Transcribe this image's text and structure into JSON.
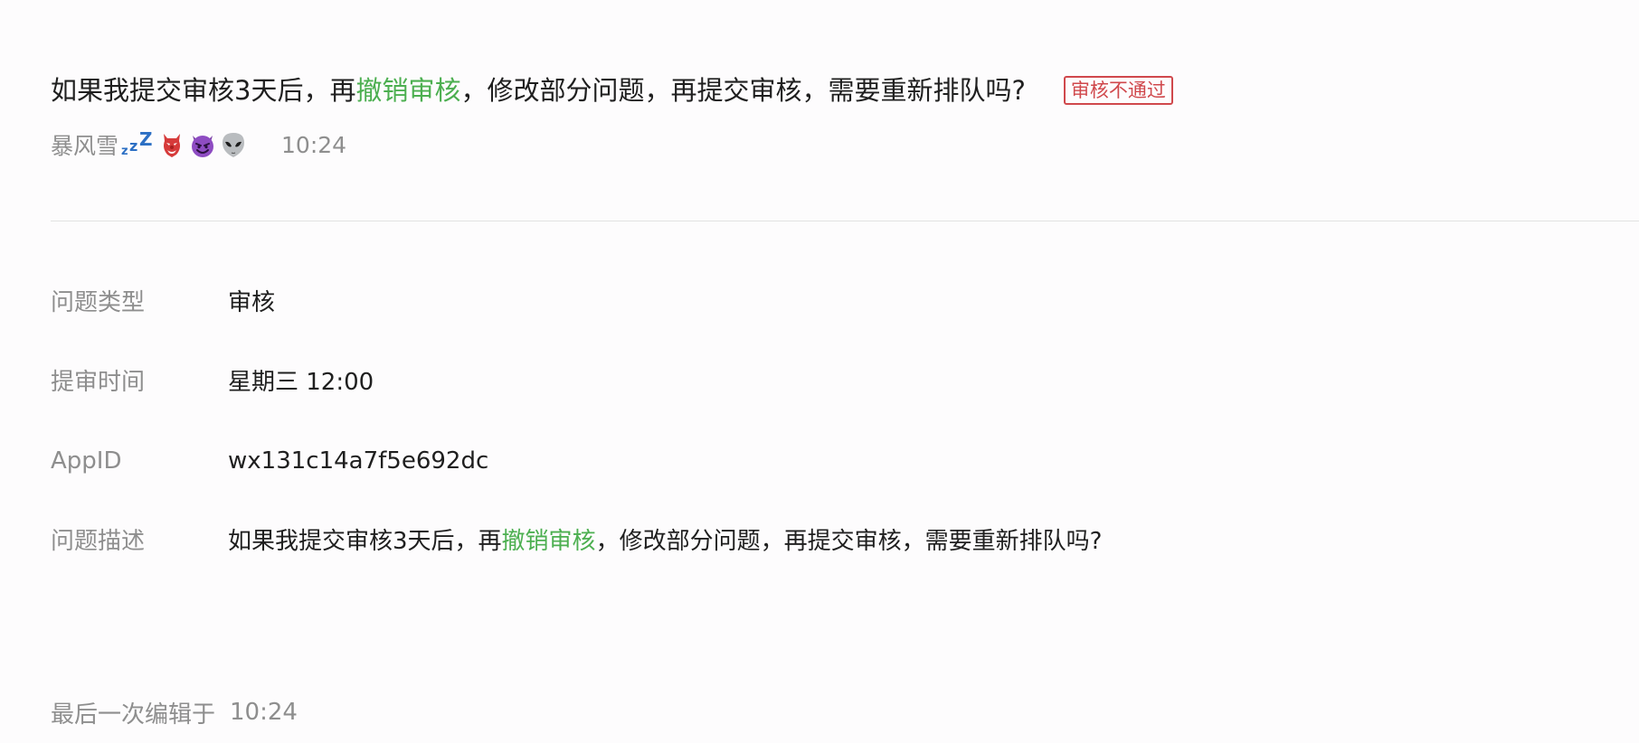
{
  "post": {
    "title_part1": "如果我提交审核3天后，再",
    "title_highlight": "撤销审核",
    "title_part2": "，修改部分问题，再提交审核，需要重新排队吗?",
    "status_badge": "审核不通过",
    "author": "暴风雪",
    "author_emoji_icons": [
      "zzz-icon",
      "goblin-icon",
      "smiling-devil-icon",
      "alien-icon"
    ],
    "time": "10:24"
  },
  "fields": {
    "type_label": "问题类型",
    "type_value": "审核",
    "submit_time_label": "提审时间",
    "submit_time_value": "星期三 12:00",
    "appid_label": "AppID",
    "appid_value": "wx131c14a7f5e692dc",
    "description_label": "问题描述",
    "description_part1": "如果我提交审核3天后，再",
    "description_highlight": "撤销审核",
    "description_part2": "，修改部分问题，再提交审核，需要重新排队吗?"
  },
  "footer": {
    "last_edited_label": "最后一次编辑于",
    "last_edited_time": "10:24"
  },
  "colors": {
    "highlight": "#4caf50",
    "badge_red": "#d0484c",
    "muted_text": "#8e8e8e",
    "divider": "#e2e2e2"
  }
}
